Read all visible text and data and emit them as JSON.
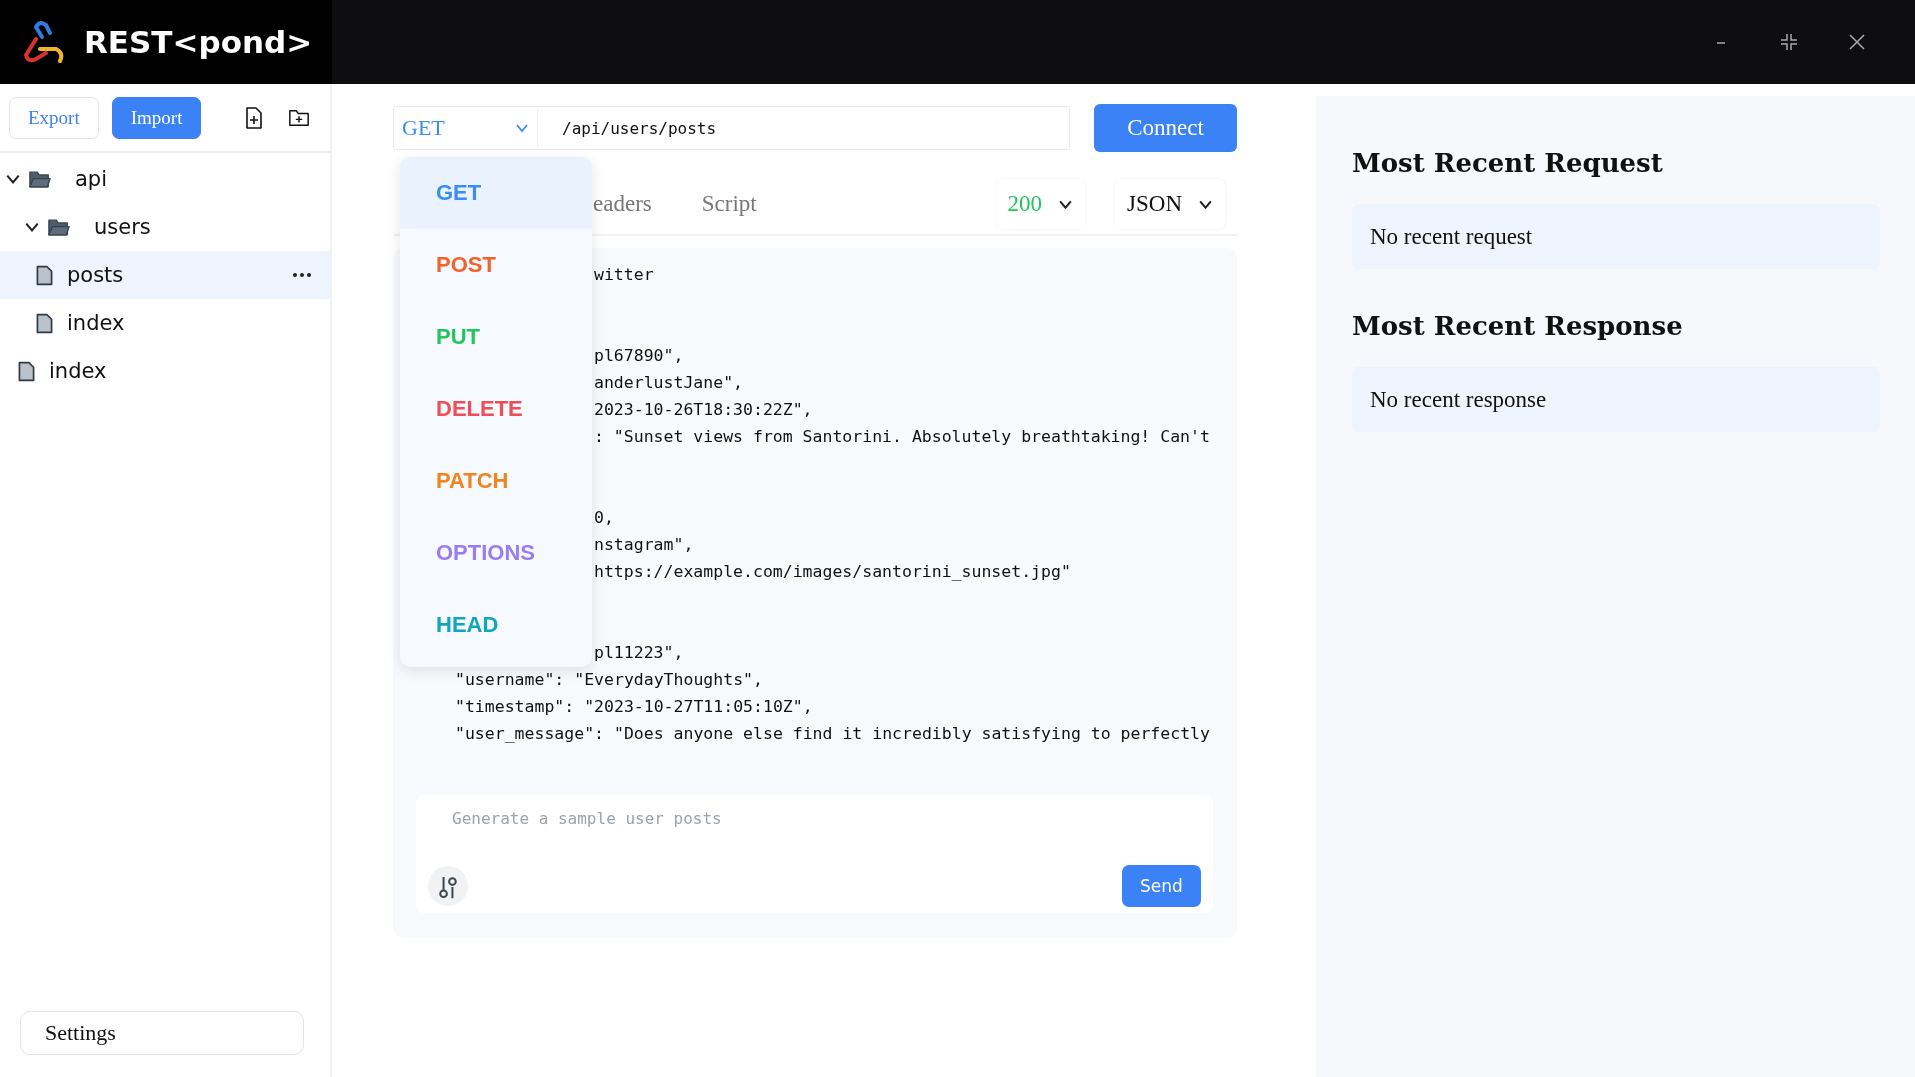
{
  "window": {
    "title": "REST<pond>"
  },
  "sidebar": {
    "buttons": [
      {
        "label": "Export",
        "kind": "outline"
      },
      {
        "label": "Import",
        "kind": "primary"
      }
    ],
    "tree": [
      {
        "label": "api",
        "kind": "folder",
        "expanded": true,
        "selected": false,
        "children": [
          {
            "label": "users",
            "kind": "folder",
            "expanded": true,
            "selected": false,
            "children": [
              {
                "label": "posts",
                "kind": "file",
                "selected": true
              },
              {
                "label": "index",
                "kind": "file",
                "selected": false
              }
            ]
          }
        ]
      },
      {
        "label": "index",
        "kind": "file",
        "selected": false
      }
    ],
    "settings": "Settings"
  },
  "request": {
    "method": "GET",
    "url": "/api/users/posts",
    "connect": "Connect",
    "methods": [
      {
        "label": "GET",
        "color": "#3b8ef0",
        "selected": true
      },
      {
        "label": "POST",
        "color": "#f2622a",
        "selected": false
      },
      {
        "label": "PUT",
        "color": "#22c55e",
        "selected": false
      },
      {
        "label": "DELETE",
        "color": "#ef4d57",
        "selected": false
      },
      {
        "label": "PATCH",
        "color": "#f0841e",
        "selected": false
      },
      {
        "label": "OPTIONS",
        "color": "#9b7cf0",
        "selected": false
      },
      {
        "label": "HEAD",
        "color": "#12a5bf",
        "selected": false
      }
    ],
    "tabs": [
      {
        "label": "eaders",
        "selected": false
      },
      {
        "label": "Script",
        "selected": false
      }
    ],
    "status": "200",
    "format": "JSON",
    "code_lines": [
      {
        "kind": "fragment",
        "text": "witter"
      },
      {
        "kind": "blank"
      },
      {
        "kind": "blank"
      },
      {
        "kind": "fragment",
        "text": "pl67890\","
      },
      {
        "kind": "fragment",
        "text": "anderlustJane\","
      },
      {
        "kind": "fragment",
        "text": "2023-10-26T18:30:22Z\","
      },
      {
        "kind": "fragment",
        "text": ": \"Sunset views from Santorini. Absolutely breathtaking! Can't"
      },
      {
        "kind": "blank"
      },
      {
        "kind": "blank"
      },
      {
        "kind": "fragment",
        "text": "0,"
      },
      {
        "kind": "fragment",
        "text": "nstagram\","
      },
      {
        "kind": "fragment",
        "text": "https://example.com/images/santorini_sunset.jpg\""
      },
      {
        "kind": "blank"
      },
      {
        "kind": "blank"
      },
      {
        "kind": "fragment",
        "text": "pl11223\","
      },
      {
        "kind": "full",
        "text": "\"username\": \"EverydayThoughts\","
      },
      {
        "kind": "full",
        "text": "\"timestamp\": \"2023-10-27T11:05:10Z\","
      },
      {
        "kind": "full",
        "text": "\"user_message\": \"Does anyone else find it incredibly satisfying to perfectly"
      }
    ],
    "prompt": {
      "placeholder": "Generate a sample user posts",
      "send": "Send"
    }
  },
  "recent": [
    {
      "heading": "Most Recent Request",
      "text": "No recent request"
    },
    {
      "heading": "Most Recent Response",
      "text": "No recent response"
    }
  ]
}
